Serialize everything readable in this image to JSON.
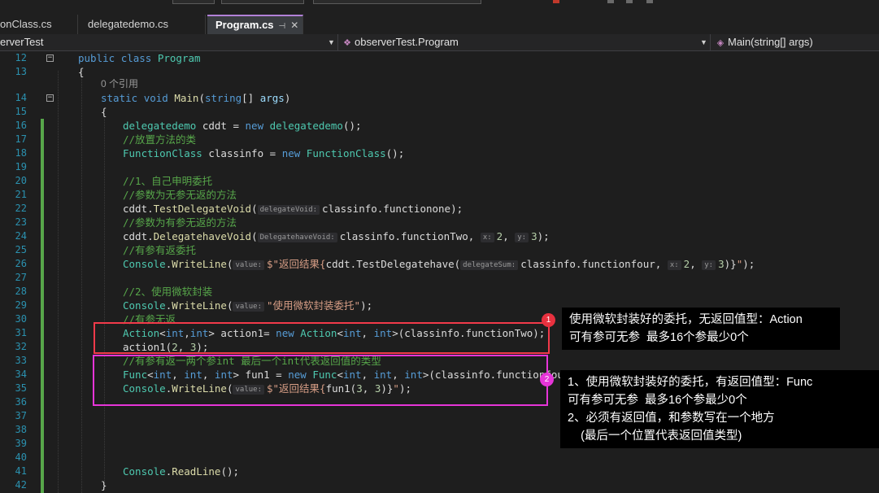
{
  "tabs": [
    {
      "label": "onClass.cs",
      "active": false
    },
    {
      "label": "delegatedemo.cs",
      "active": false
    },
    {
      "label": "Program.cs",
      "active": true
    }
  ],
  "tab_pin_glyph": "⊣",
  "tab_close_glyph": "✕",
  "navbar": {
    "project": "erverTest",
    "class_path": "observerTest.Program",
    "member": "Main(string[] args)",
    "icons": {
      "class": "class-icon",
      "method": "method-icon"
    }
  },
  "line_numbers": [
    "12",
    "13",
    "14",
    "15",
    "16",
    "17",
    "18",
    "19",
    "20",
    "21",
    "22",
    "23",
    "24",
    "25",
    "26",
    "27",
    "28",
    "29",
    "30",
    "31",
    "32",
    "33",
    "34",
    "35",
    "36",
    "37",
    "38",
    "39",
    "40",
    "41",
    "42"
  ],
  "code": {
    "l12": {
      "k1": "public",
      "k2": "class",
      "t1": "Program"
    },
    "l13": {
      "p1": "{"
    },
    "refs": "0 个引用",
    "l14": {
      "k1": "static",
      "k2": "void",
      "m1": "Main",
      "p1": "(",
      "k3": "string",
      "p2": "[] ",
      "a1": "args",
      "p3": ")"
    },
    "l15": {
      "p1": "{"
    },
    "l16": {
      "t1": "delegatedemo",
      "p1": " cddt = ",
      "k1": "new",
      "t2": "delegatedemo",
      "p2": "();"
    },
    "l17": {
      "c1": "//放置方法的类"
    },
    "l18": {
      "t1": "FunctionClass",
      "p1": " classinfo = ",
      "k1": "new",
      "t2": "FunctionClass",
      "p2": "();"
    },
    "l20": {
      "c1": "//1、自己申明委托"
    },
    "l21": {
      "c1": "//参数为无参无返的方法"
    },
    "l22": {
      "p1": "cddt.",
      "m1": "TestDelegateVoid",
      "p2": "(",
      "h1": "delegateVoid:",
      "p3": "classinfo.functionone);"
    },
    "l23": {
      "c1": "//参数为有参无返的方法"
    },
    "l24": {
      "p1": "cddt.",
      "m1": "DelegatehaveVoid",
      "p2": "(",
      "h1": "DelegatehaveVoid:",
      "p3": "classinfo.functionTwo, ",
      "h2": "x:",
      "n1": "2",
      "p4": ", ",
      "h3": "y:",
      "n2": "3",
      "p5": ");"
    },
    "l25": {
      "c1": "//有参有返委托"
    },
    "l26": {
      "t1": "Console",
      "p1": ".",
      "m1": "WriteLine",
      "p2": "(",
      "h1": "value:",
      "s1": "$\"返回结果{",
      "p3": "cddt.TestDelegatehave(",
      "h2": "delegateSum:",
      "p4": "classinfo.functionfour, ",
      "h3": "x:",
      "n1": "2",
      "p5": ", ",
      "h4": "y:",
      "n2": "3",
      "p6": ")}",
      "s2": "\"",
      "p7": ");"
    },
    "l28": {
      "c1": "//2、使用微软封装"
    },
    "l29": {
      "t1": "Console",
      "p1": ".",
      "m1": "WriteLine",
      "p2": "(",
      "h1": "value:",
      "s1": "\"使用微软封装委托\"",
      "p3": ");"
    },
    "l30": {
      "c1": "//有参无返"
    },
    "l31": {
      "t1": "Action",
      "p1": "<",
      "k1": "int",
      "p2": ",",
      "k2": "int",
      "p3": "> action1= ",
      "k3": "new",
      "t2": "Action",
      "p4": "<",
      "k4": "int",
      "p5": ", ",
      "k5": "int",
      "p6": ">(classinfo.functionTwo);"
    },
    "l32": {
      "p1": "action1(",
      "n1": "2",
      "p2": ", ",
      "n2": "3",
      "p3": ");"
    },
    "l33": {
      "c1": "//有参有返一两个参int 最后一个int代表返回值的类型"
    },
    "l34": {
      "t1": "Func",
      "p1": "<",
      "k1": "int",
      "p2": ", ",
      "k2": "int",
      "p3": ", ",
      "k3": "int",
      "p4": "> fun1 = ",
      "k4": "new",
      "t2": "Func",
      "p5": "<",
      "k5": "int",
      "p6": ", ",
      "k6": "int",
      "p7": ", ",
      "k7": "int",
      "p8": ">(classinfo.functionfour);"
    },
    "l35": {
      "t1": "Console",
      "p1": ".",
      "m1": "WriteLine",
      "p2": "(",
      "h1": "value:",
      "s1": "$\"返回结果{",
      "p3": "fun1(",
      "n1": "3",
      "p4": ", ",
      "n2": "3",
      "p5": ")}",
      "s2": "\"",
      "p6": ");"
    },
    "l41": {
      "t1": "Console",
      "p1": ".",
      "m1": "ReadLine",
      "p2": "();"
    },
    "l42": {
      "p1": "}"
    }
  },
  "annotations": {
    "badge1": "1",
    "badge2": "2",
    "note1": "使用微软封装好的委托，无返回值型：Action\n可有参可无参  最多16个参最少0个",
    "note2": "1、使用微软封装好的委托，有返回值型：Func\n可有参可无参  最多16个参最少0个\n2、必须有返回值，和参数写在一个地方\n    (最后一个位置代表返回值类型)",
    "colors": {
      "box1": "#f23a4a",
      "box2": "#e635d8",
      "badge1": "#e8313f",
      "badge2": "#e635d8"
    }
  }
}
